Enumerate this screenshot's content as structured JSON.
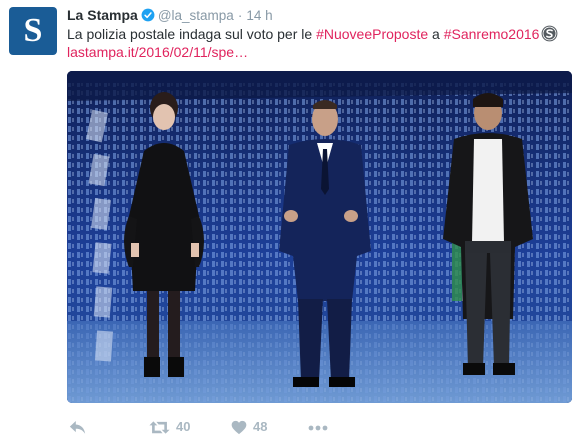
{
  "tweet": {
    "author_name": "La Stampa",
    "handle": "@la_stampa",
    "separator": "·",
    "time": "14 h",
    "avatar_letter": "S",
    "text_prefix": "La polizia postale indaga sul voto per le ",
    "hashtag_1": "#NuoveeProposte",
    "text_middle": " a ",
    "hashtag_2": "#Sanremo2016",
    "link": "lastampa.it/2016/02/11/spe…",
    "accent_color": "#e0245e",
    "verified_icon": "verified-badge-icon",
    "hashtag_badge_icon": "sanremo-s-badge-icon"
  },
  "actions": {
    "reply_icon": "reply-icon",
    "retweet_icon": "retweet-icon",
    "retweet_count": "40",
    "like_icon": "heart-icon",
    "like_count": "48",
    "more_icon": "more-dots-icon"
  }
}
